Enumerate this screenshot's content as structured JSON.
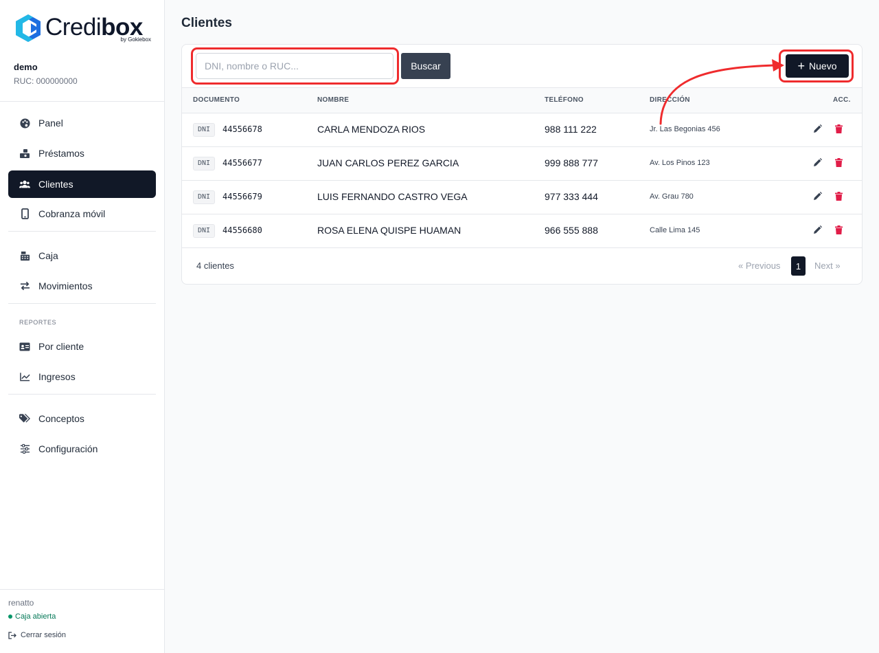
{
  "brand": {
    "name_light": "Credi",
    "name_bold": "box",
    "sub": "by Gokiebox",
    "colors": {
      "primary": "#111827",
      "logo_cyan": "#22b8e6",
      "logo_blue": "#1d6fe0"
    }
  },
  "company": {
    "name": "demo",
    "ruc": "RUC: 000000000"
  },
  "nav": {
    "panel": "Panel",
    "prestamos": "Préstamos",
    "clientes": "Clientes",
    "cobranza": "Cobranza móvil",
    "caja": "Caja",
    "movimientos": "Movimientos",
    "section_reportes": "REPORTES",
    "por_cliente": "Por cliente",
    "ingresos": "Ingresos",
    "conceptos": "Conceptos",
    "configuracion": "Configuración"
  },
  "user": {
    "name": "renatto",
    "caja_status": "Caja abierta",
    "logout": "Cerrar sesión"
  },
  "page": {
    "title": "Clientes"
  },
  "toolbar": {
    "search_placeholder": "DNI, nombre o RUC...",
    "search_value": "",
    "buscar_label": "Buscar",
    "nuevo_label": "Nuevo"
  },
  "table": {
    "headers": [
      "DOCUMENTO",
      "NOMBRE",
      "TELÉFONO",
      "DIRECCIÓN",
      "ACC."
    ],
    "rows": [
      {
        "doc_type": "DNI",
        "doc_number": "44556678",
        "name": "CARLA MENDOZA RIOS",
        "phone": "988 111 222",
        "address": "Jr. Las Begonias 456"
      },
      {
        "doc_type": "DNI",
        "doc_number": "44556677",
        "name": "JUAN CARLOS PEREZ GARCIA",
        "phone": "999 888 777",
        "address": "Av. Los Pinos 123"
      },
      {
        "doc_type": "DNI",
        "doc_number": "44556679",
        "name": "LUIS FERNANDO CASTRO VEGA",
        "phone": "977 333 444",
        "address": "Av. Grau 780"
      },
      {
        "doc_type": "DNI",
        "doc_number": "44556680",
        "name": "ROSA ELENA QUISPE HUAMAN",
        "phone": "966 555 888",
        "address": "Calle Lima 145"
      }
    ]
  },
  "footer": {
    "count": "4 clientes",
    "prev": "« Previous",
    "page": "1",
    "next": "Next »"
  },
  "icons": {
    "panel": "palette-icon",
    "prestamos": "money-hand-icon",
    "clientes": "users-icon",
    "cobranza": "mobile-icon",
    "caja": "cash-register-icon",
    "movimientos": "exchange-icon",
    "por_cliente": "id-card-icon",
    "ingresos": "line-chart-icon",
    "conceptos": "tags-icon",
    "configuracion": "sliders-icon",
    "edit": "pencil-icon",
    "delete": "trash-icon",
    "logout": "logout-icon"
  },
  "annotation_color": "#ef2b2d"
}
